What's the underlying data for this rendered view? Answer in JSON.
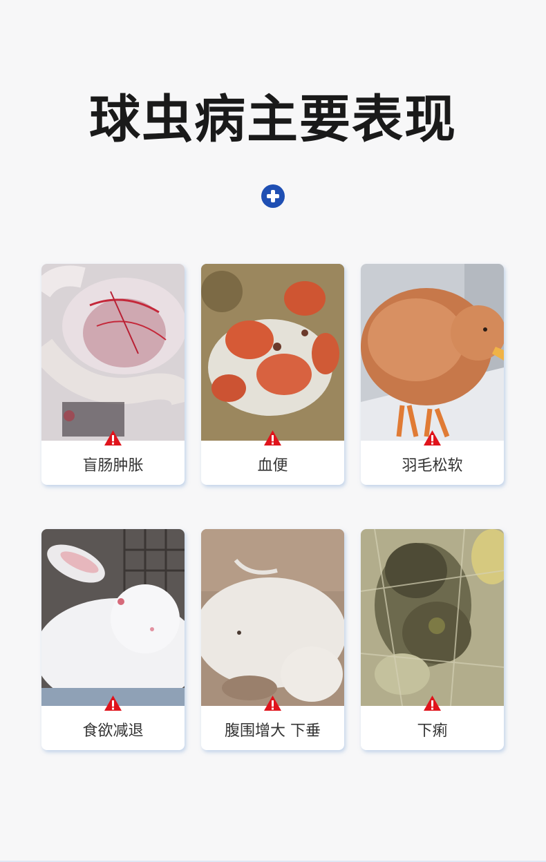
{
  "title": "球虫病主要表现",
  "accent_color": "#1f4fb3",
  "warning_color": "#e0141c",
  "symptoms": [
    {
      "label": "盲肠肿胀",
      "photo": "intestine-photo"
    },
    {
      "label": "血便",
      "photo": "bloody-stool-photo"
    },
    {
      "label": "羽毛松软",
      "photo": "chicken-photo"
    },
    {
      "label": "食欲减退",
      "photo": "white-rabbit-photo"
    },
    {
      "label": "腹围增大 下垂",
      "photo": "lying-rabbit-photo"
    },
    {
      "label": "下痢",
      "photo": "diarrhea-photo"
    }
  ]
}
